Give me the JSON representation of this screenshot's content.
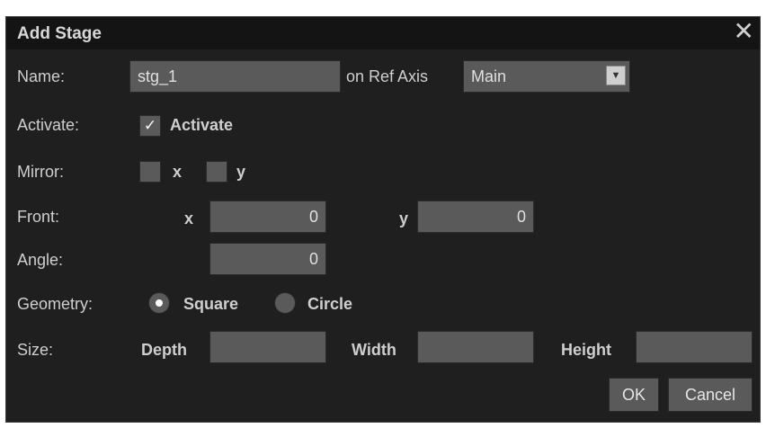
{
  "dialog": {
    "title": "Add Stage",
    "close_icon": "close-icon"
  },
  "name_row": {
    "label": "Name:",
    "value": "stg_1",
    "ref_axis_label": "on Ref Axis",
    "ref_axis_value": "Main",
    "dropdown_icon": "chevron-down-icon"
  },
  "activate_row": {
    "label": "Activate:",
    "checkbox_label": "Activate",
    "checked": true,
    "check_glyph": "✓"
  },
  "mirror_row": {
    "label": "Mirror:",
    "x_label": "x",
    "y_label": "y",
    "x_checked": false,
    "y_checked": false
  },
  "front_row": {
    "label": "Front:",
    "x_label": "x",
    "x_value": "0",
    "y_label": "y",
    "y_value": "0"
  },
  "angle_row": {
    "label": "Angle:",
    "value": "0"
  },
  "geometry_row": {
    "label": "Geometry:",
    "options": [
      "Square",
      "Circle"
    ],
    "selected": "Square"
  },
  "size_row": {
    "label": "Size:",
    "depth_label": "Depth",
    "width_label": "Width",
    "height_label": "Height",
    "depth_value": "",
    "width_value": "",
    "height_value": ""
  },
  "buttons": {
    "ok": "OK",
    "cancel": "Cancel"
  }
}
